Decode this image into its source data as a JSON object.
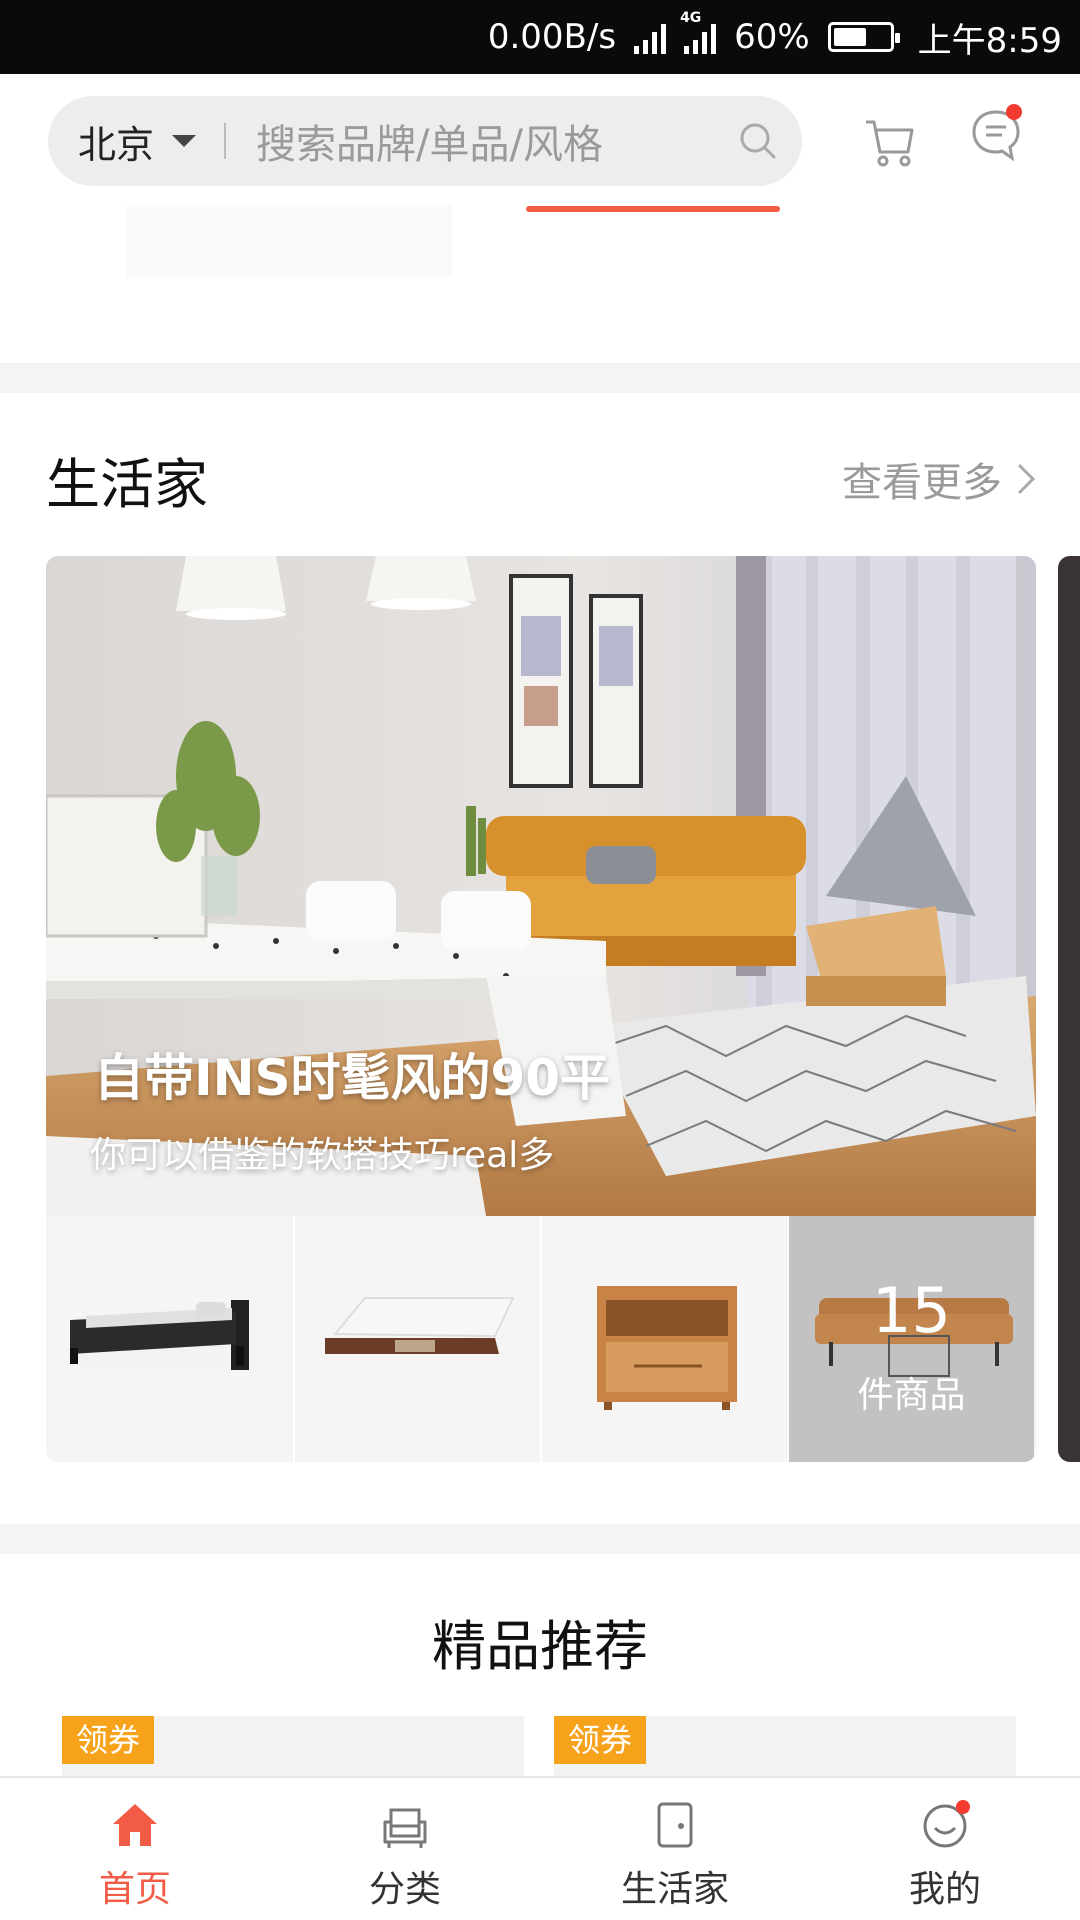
{
  "status_bar": {
    "speed": "0.00B/s",
    "network": "4G",
    "battery_percent_label": "60%",
    "battery_level": 0.6,
    "time": "上午8:59"
  },
  "header": {
    "city": "北京",
    "search_placeholder": "搜索品牌/单品/风格",
    "message_badge": true
  },
  "section_life": {
    "title": "生活家",
    "more_label": "查看更多",
    "card": {
      "title": "自带INS时髦风的90平",
      "subtitle": "你可以借鉴的软搭技巧real多",
      "thumbnails": [
        "bed-icon",
        "mattress-icon",
        "nightstand-icon"
      ],
      "count_number": "15",
      "count_label": "件商品"
    }
  },
  "section_recommend": {
    "title": "精品推荐",
    "items": [
      {
        "tag": "领券"
      },
      {
        "tag": "领券"
      }
    ]
  },
  "bottom_nav": {
    "items": [
      {
        "label": "首页",
        "icon": "home-icon",
        "active": true
      },
      {
        "label": "分类",
        "icon": "sofa-icon",
        "active": false
      },
      {
        "label": "生活家",
        "icon": "door-icon",
        "active": false
      },
      {
        "label": "我的",
        "icon": "profile-icon",
        "active": false
      }
    ]
  },
  "colors": {
    "accent": "#f25c46",
    "coupon": "#f7a21b",
    "badge": "#f33a2e"
  }
}
